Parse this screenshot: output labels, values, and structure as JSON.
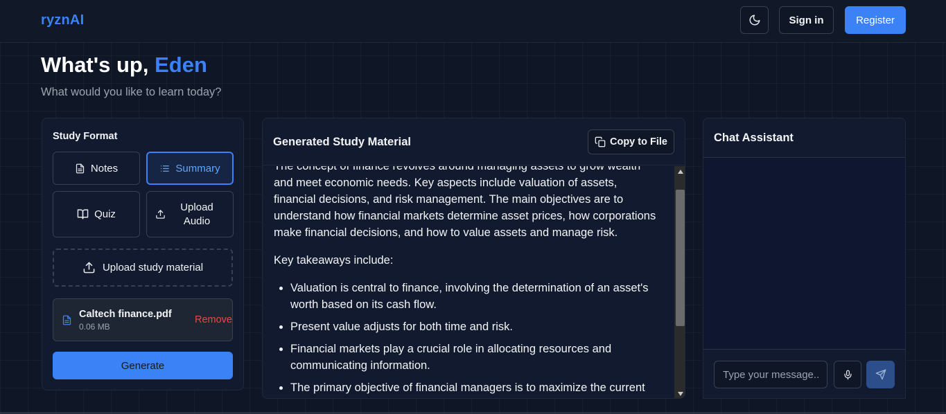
{
  "header": {
    "logo": "ryznAI",
    "sign_in": "Sign in",
    "register": "Register"
  },
  "hero": {
    "greeting_prefix": "What's up, ",
    "user_name": "Eden",
    "subtitle": "What would you like to learn today?"
  },
  "study_format": {
    "label": "Study Format",
    "buttons": [
      {
        "label": "Notes",
        "icon": "document-icon",
        "active": false
      },
      {
        "label": "Summary",
        "icon": "list-icon",
        "active": true
      },
      {
        "label": "Quiz",
        "icon": "book-open-icon",
        "active": false
      },
      {
        "label": "Upload Audio",
        "icon": "upload-icon",
        "active": false
      }
    ],
    "upload_material": "Upload study material",
    "file": {
      "name": "Caltech finance.pdf",
      "size": "0.06 MB",
      "remove": "Remove"
    },
    "generate": "Generate"
  },
  "study_material": {
    "title": "Generated Study Material",
    "copy_button": "Copy to File",
    "paragraphs": [
      "The concept of finance revolves around managing assets to grow wealth and meet economic needs. Key aspects include valuation of assets, financial decisions, and risk management. The main objectives are to understand how financial markets determine asset prices, how corporations make financial decisions, and how to value assets and manage risk.",
      "Key takeaways include:"
    ],
    "bullets": [
      "Valuation is central to finance, involving the determination of an asset's worth based on its cash flow.",
      "Present value adjusts for both time and risk.",
      "Financial markets play a crucial role in allocating resources and communicating information.",
      "The primary objective of financial managers is to maximize the current"
    ]
  },
  "chat": {
    "title": "Chat Assistant",
    "input_placeholder": "Type your message..."
  },
  "colors": {
    "accent": "#3b82f6",
    "danger": "#ef4444",
    "background": "#0f1626"
  }
}
